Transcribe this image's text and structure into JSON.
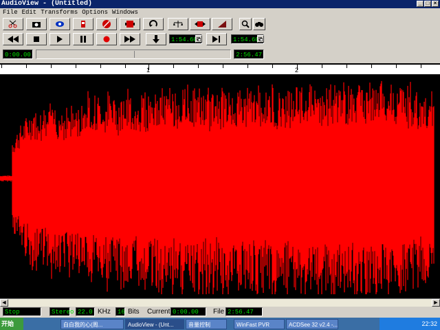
{
  "window": {
    "title": "AudioView - (Untitled)",
    "buttons": [
      "_",
      "□",
      "×"
    ]
  },
  "menu": [
    "File",
    "Edit",
    "Transforms",
    "Options",
    "Windows"
  ],
  "transport": {
    "time_a": "1:54.60",
    "time_b": "1:54.60",
    "position": "0:00.00",
    "length": "2:56.47"
  },
  "ruler": {
    "labels": [
      "1",
      "2"
    ]
  },
  "status": {
    "state": "Stop",
    "channels": "Stereo",
    "rate": "22.0",
    "rate_unit": "KHz",
    "bits": "16",
    "bits_unit": "Bits",
    "current_label": "Current",
    "current": "0:00.00",
    "file_label": "File",
    "file": "2:56.47"
  },
  "taskbar": {
    "start": "开始",
    "tasks": [
      "白白我的心(周...",
      "AudioView - (Unt...",
      "音量控制",
      "WinFast PVR",
      "ACDSee 32 v2.4 -..."
    ],
    "clock": "22:32"
  },
  "colors": {
    "waveform": "#ff0000",
    "background": "#000000",
    "lcd_text": "#00e000"
  }
}
